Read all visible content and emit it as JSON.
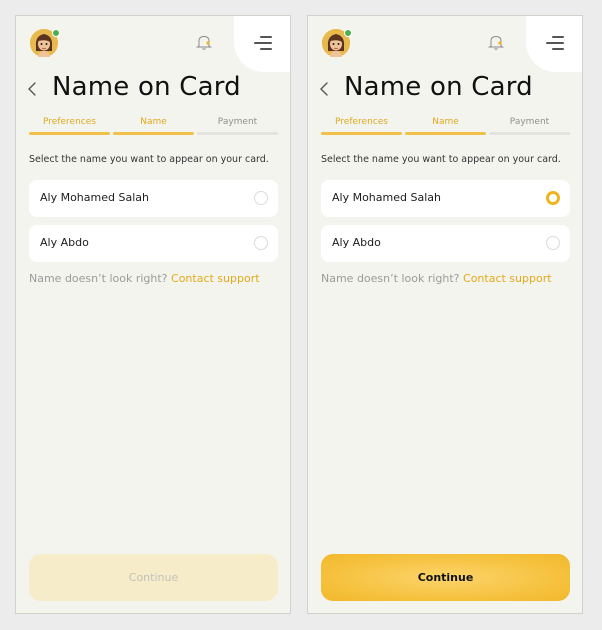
{
  "screens": [
    {
      "title": "Name on Card",
      "steps": [
        {
          "label": "Preferences",
          "state": "active"
        },
        {
          "label": "Name",
          "state": "active"
        },
        {
          "label": "Payment",
          "state": "inactive"
        }
      ],
      "instruction": "Select the name you want to appear on your card.",
      "options": [
        {
          "label": "Aly Mohamed Salah",
          "selected": false
        },
        {
          "label": "Aly Abdo",
          "selected": false
        }
      ],
      "support_text": "Name doesn’t look right?",
      "support_link": "Contact support",
      "continue_label": "Continue",
      "continue_enabled": false
    },
    {
      "title": "Name on Card",
      "steps": [
        {
          "label": "Preferences",
          "state": "active"
        },
        {
          "label": "Name",
          "state": "active"
        },
        {
          "label": "Payment",
          "state": "inactive"
        }
      ],
      "instruction": "Select the name you want to appear on your card.",
      "options": [
        {
          "label": "Aly Mohamed Salah",
          "selected": true
        },
        {
          "label": "Aly Abdo",
          "selected": false
        }
      ],
      "support_text": "Name doesn’t look right?",
      "support_link": "Contact support",
      "continue_label": "Continue",
      "continue_enabled": true
    }
  ],
  "icons": {
    "avatar": "avatar",
    "online": "online-status-dot",
    "notifications": "bell-icon",
    "menu": "menu-icon",
    "back": "back-chevron-icon"
  },
  "colors": {
    "accent": "#f0b51e",
    "accent_text": "#e3a91a",
    "background": "#f4f4ef",
    "card": "#ffffff",
    "online": "#4caf50"
  }
}
